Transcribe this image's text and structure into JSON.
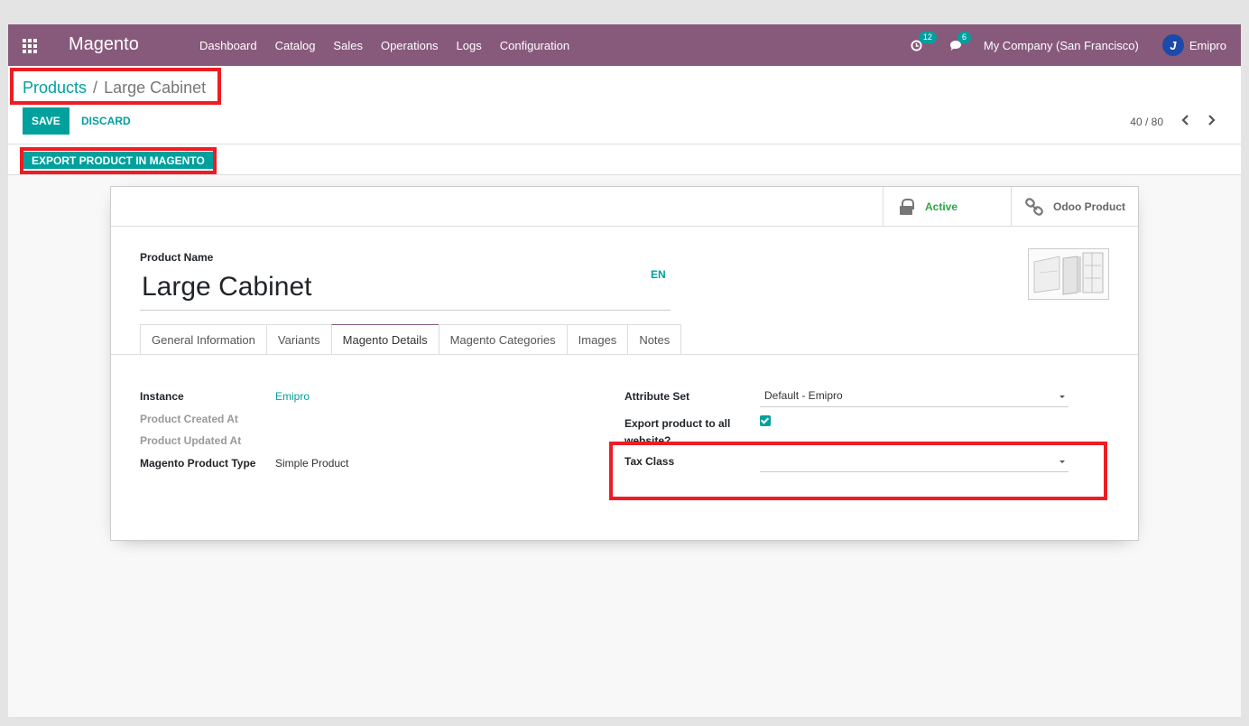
{
  "navbar": {
    "brand": "Magento",
    "menu": [
      "Dashboard",
      "Catalog",
      "Sales",
      "Operations",
      "Logs",
      "Configuration"
    ],
    "activity_count": "12",
    "message_count": "6",
    "company": "My Company (San Francisco)",
    "user_name": "Emipro"
  },
  "breadcrumb": {
    "parent": "Products",
    "separator": "/",
    "current": "Large Cabinet"
  },
  "actions": {
    "save": "SAVE",
    "discard": "DISCARD"
  },
  "pager": {
    "value": "40 / 80",
    "prev": "‹",
    "next": "›"
  },
  "statusbar": {
    "export": "EXPORT PRODUCT IN MAGENTO"
  },
  "smart_buttons": {
    "active": "Active",
    "odoo_product": "Odoo Product"
  },
  "form": {
    "title_label": "Product Name",
    "title": "Large Cabinet",
    "lang": "EN",
    "tabs": [
      "General Information",
      "Variants",
      "Magento Details",
      "Magento Categories",
      "Images",
      "Notes"
    ],
    "active_tab": "Magento Details",
    "left": {
      "instance_label": "Instance",
      "instance_value": "Emipro",
      "created_label": "Product Created At",
      "updated_label": "Product Updated At",
      "type_label": "Magento Product Type",
      "type_value": "Simple Product"
    },
    "right": {
      "attribute_set_label": "Attribute Set",
      "attribute_set_value": "Default - Emipro",
      "export_all_label_1": "Export product to all",
      "export_all_label_2": "website?",
      "export_all_checked": true,
      "tax_class_label": "Tax Class",
      "tax_class_value": ""
    }
  },
  "colors": {
    "navbar": "#875a7b",
    "accent": "#00a09d",
    "highlight": "#ee1c24",
    "active": "#28a745"
  }
}
